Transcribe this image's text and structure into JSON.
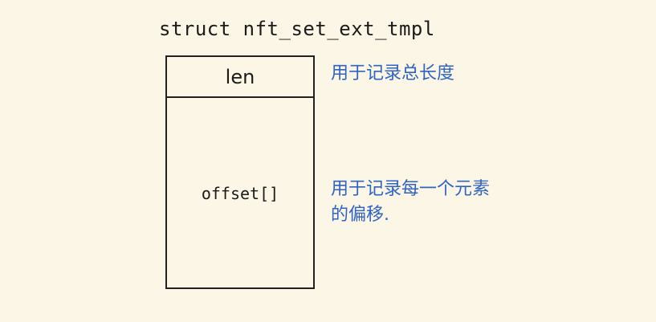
{
  "struct": {
    "name": "struct nft_set_ext_tmpl",
    "fields": [
      {
        "name": "len"
      },
      {
        "name": "offset[]"
      }
    ]
  },
  "annotations": {
    "len": "用于记录总长度",
    "offset": [
      "用于记录每一个元素",
      "的偏移."
    ]
  },
  "colors": {
    "background": "#fcf6e6",
    "ink": "#1a1a1a",
    "annotation": "#2f63c4"
  }
}
